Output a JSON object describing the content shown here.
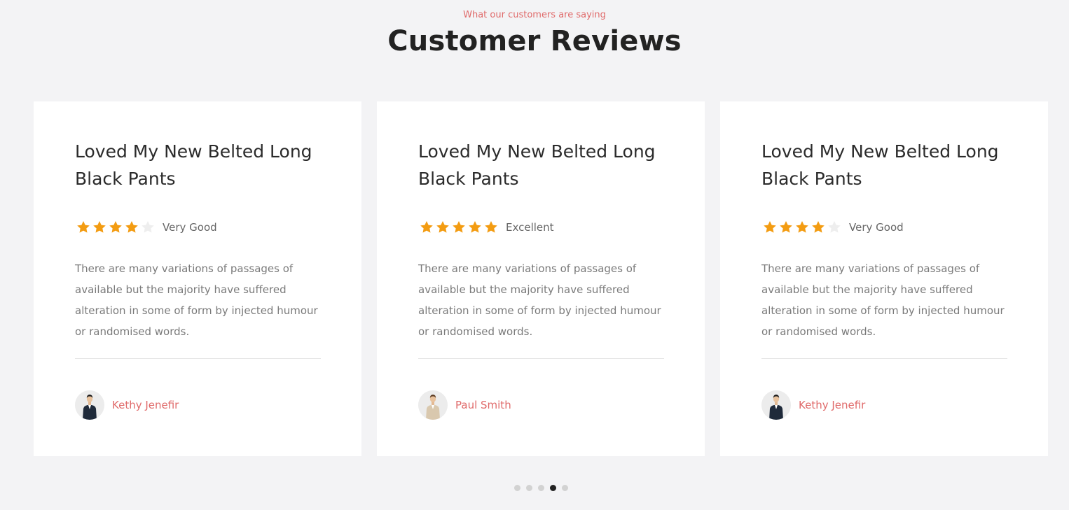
{
  "header": {
    "subtitle": "What our customers are saying",
    "title": "Customer Reviews"
  },
  "colors": {
    "accent": "#e06a6a",
    "star_filled": "#f39c12",
    "star_empty": "#eeeeee",
    "background": "#f3f3f5"
  },
  "reviews": [
    {
      "title": "Loved My New Belted Long Black Pants",
      "rating": 4,
      "rating_max": 5,
      "rating_label": "Very Good",
      "text": "There are many variations of passages of available but the majority have suffered alteration in some of form by injected humour or randomised words.",
      "author": "Kethy Jenefir",
      "avatar": "man-dark-suit-avatar"
    },
    {
      "title": "Loved My New Belted Long Black Pants",
      "rating": 5,
      "rating_max": 5,
      "rating_label": "Excellent",
      "text": "There are many variations of passages of available but the majority have suffered alteration in some of form by injected humour or randomised words.",
      "author": "Paul Smith",
      "avatar": "man-beige-suit-avatar"
    },
    {
      "title": "Loved My New Belted Long Black Pants",
      "rating": 4,
      "rating_max": 5,
      "rating_label": "Very Good",
      "text": "There are many variations of passages of available but the majority have suffered alteration in some of form by injected humour or randomised words.",
      "author": "Kethy Jenefir",
      "avatar": "man-dark-suit-avatar"
    }
  ],
  "pagination": {
    "count": 5,
    "active_index": 3
  }
}
